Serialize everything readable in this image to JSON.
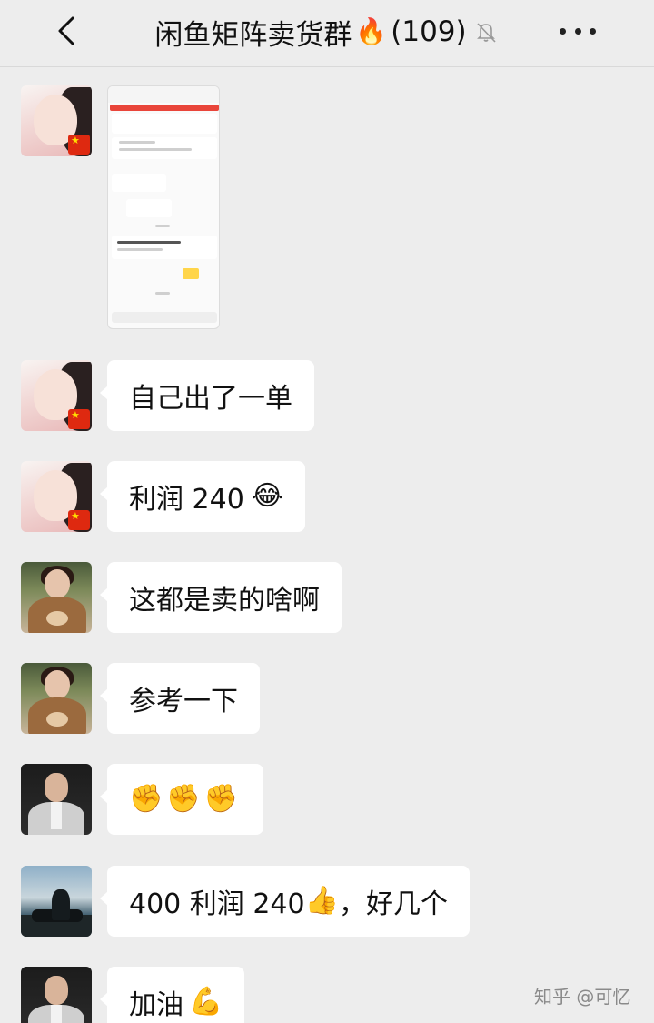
{
  "header": {
    "title": "闲鱼矩阵卖货群",
    "fire_icon": "🔥",
    "member_count": "(109)",
    "icons": [
      "back-icon",
      "mute-icon",
      "more-icon"
    ]
  },
  "messages": [
    {
      "sender_avatar": "avatar-girl-flag",
      "type": "image",
      "content": "screenshot-image"
    },
    {
      "sender_avatar": "avatar-girl-flag",
      "type": "text",
      "text": "自己出了一单"
    },
    {
      "sender_avatar": "avatar-girl-flag",
      "type": "text",
      "text": "利润 240",
      "emoji": "😂"
    },
    {
      "sender_avatar": "avatar-woman-bear",
      "type": "text",
      "text": "这都是卖的啥啊"
    },
    {
      "sender_avatar": "avatar-woman-bear",
      "type": "text",
      "text": "参考一下"
    },
    {
      "sender_avatar": "avatar-man-suit",
      "type": "text",
      "text": "",
      "emoji": "✊✊✊"
    },
    {
      "sender_avatar": "avatar-man-sea",
      "type": "text",
      "text": "400 利润 240",
      "emoji": "👍",
      "text_after": "，好几个"
    },
    {
      "sender_avatar": "avatar-man-suit",
      "type": "text",
      "text": "加油",
      "emoji": "💪"
    }
  ],
  "watermark": "知乎 @可忆",
  "colors": {
    "background": "#ededed",
    "bubble": "#ffffff",
    "text": "#111111"
  }
}
